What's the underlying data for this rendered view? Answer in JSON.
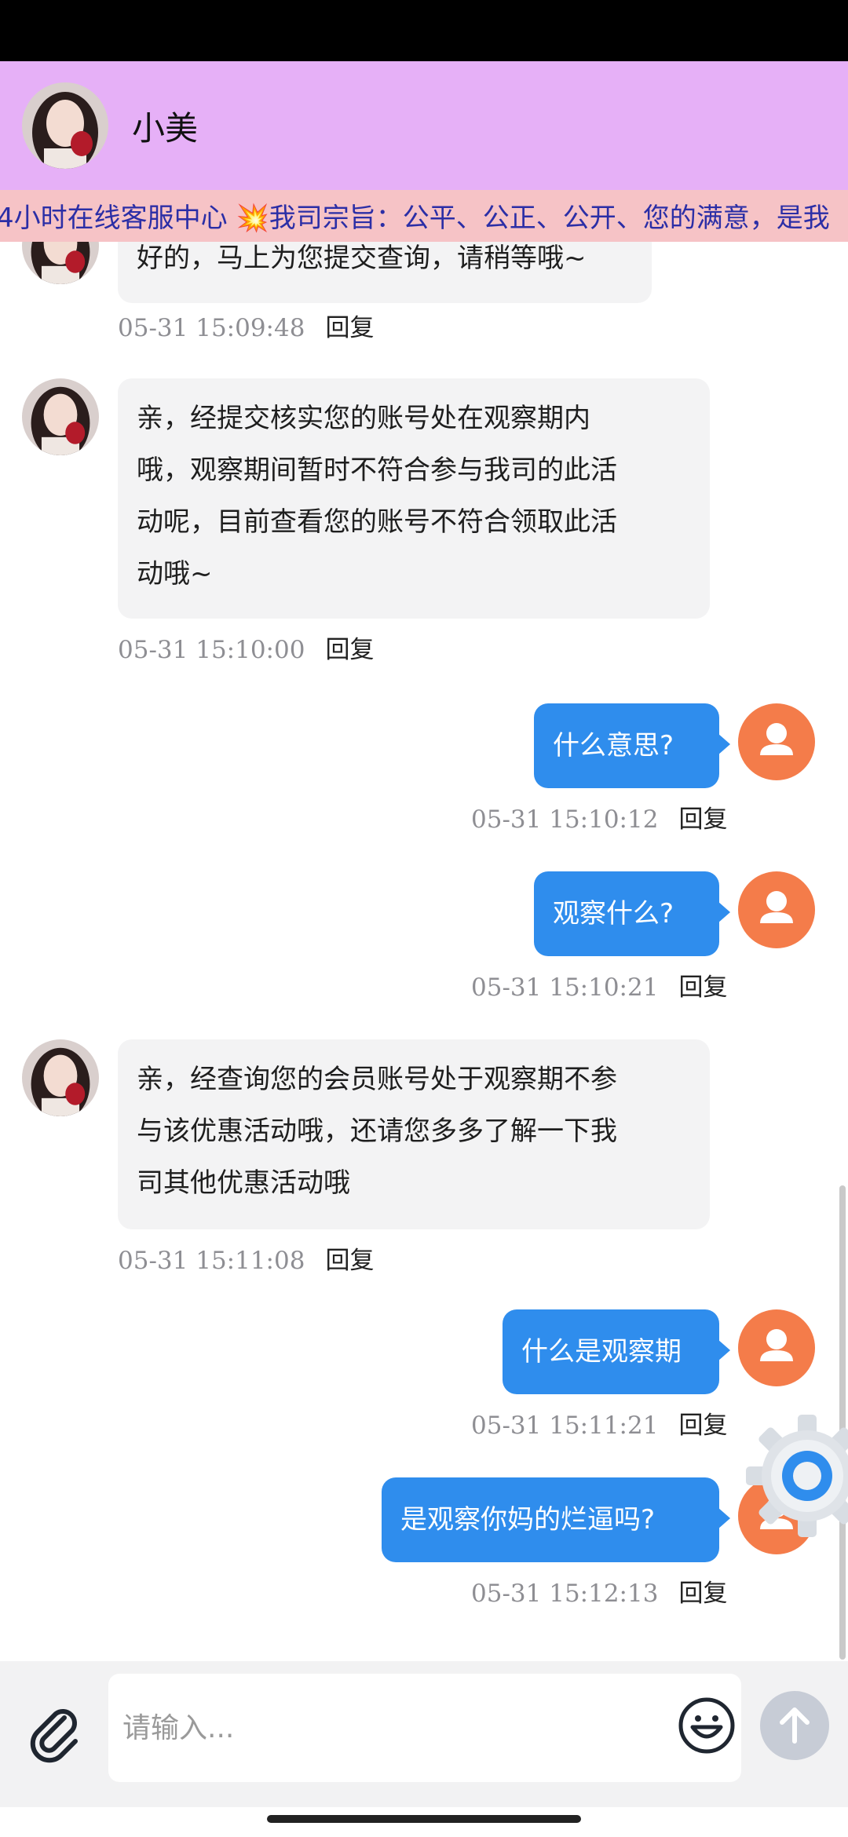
{
  "header": {
    "title": "小美",
    "avatar_icon": "avatar-photo"
  },
  "marquee": {
    "text": "4小时在线客服中心 💥我司宗旨：公平、公正、公开、您的满意，是我"
  },
  "messages": [
    {
      "side": "left",
      "lines": [
        "好的，马上为您提交查询，请稍等哦~"
      ],
      "time": "05-31 15:09:48",
      "reply": "回复"
    },
    {
      "side": "left",
      "lines": [
        "亲，经提交核实您的账号处在观察期内",
        "哦，观察期间暂时不符合参与我司的此活",
        "动呢，目前查看您的账号不符合领取此活",
        "动哦~"
      ],
      "time": "05-31 15:10:00",
      "reply": "回复"
    },
    {
      "side": "right",
      "text": "什么意思?",
      "time": "05-31 15:10:12",
      "reply": "回复"
    },
    {
      "side": "right",
      "text": "观察什么?",
      "time": "05-31 15:10:21",
      "reply": "回复"
    },
    {
      "side": "left",
      "lines": [
        "亲，经查询您的会员账号处于观察期不参",
        "与该优惠活动哦，还请您多多了解一下我",
        "司其他优惠活动哦"
      ],
      "time": "05-31 15:11:08",
      "reply": "回复"
    },
    {
      "side": "right",
      "text": "什么是观察期",
      "time": "05-31 15:11:21",
      "reply": "回复"
    },
    {
      "side": "right",
      "text": "是观察你妈的烂逼吗?",
      "time": "05-31 15:12:13",
      "reply": "回复"
    }
  ],
  "input": {
    "placeholder": "请输入..."
  },
  "icons": {
    "attach": "paperclip-icon",
    "emoji": "smiley-icon",
    "send": "arrow-up-icon",
    "settings": "gear-icon",
    "user": "user-icon"
  },
  "colors": {
    "header_bg": "#e6b0f7",
    "marquee_bg": "#f6c3c6",
    "bubble_right": "#2f8ded",
    "user_avatar": "#f47c4a"
  }
}
